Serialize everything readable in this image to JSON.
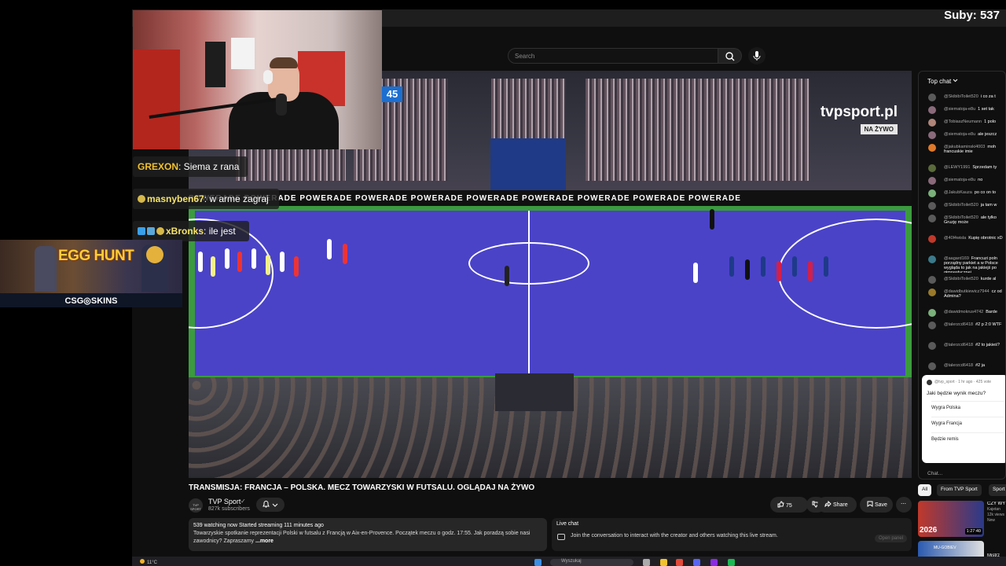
{
  "overlay": {
    "subs": "Suby: 537",
    "chat": [
      {
        "user": "GREXON",
        "text": ": Siema z rana"
      },
      {
        "user": "masnyben67",
        "text": ": w arme zagraj"
      },
      {
        "user": "xBronks",
        "text": ": ile jest"
      }
    ],
    "ad": {
      "title": "EGG HUNT",
      "brand": "CSG◎SKINS"
    }
  },
  "youtube": {
    "search_placeholder": "Search",
    "video": {
      "score": "45",
      "watermark": "tvpsport.pl",
      "watermark_live": "NA ŻYWO",
      "adboard": "POWERADE   POWERADE   POWERADE   POWERADE   POWERADE   POWERADE   POWERADE   POWERADE   POWERADE   POWERADE"
    },
    "title": "TRANSMISJA: FRANCJA – POLSKA. MECZ TOWARZYSKI W FUTSALU. OGLĄDAJ NA ŻYWO",
    "channel": {
      "name": "TVP Sport",
      "verified": "✓",
      "subs": "827k subscribers",
      "avatar_text": "TVP SPORT"
    },
    "actions": {
      "likes": "75",
      "share": "Share",
      "save": "Save",
      "more": "⋯"
    },
    "description": {
      "stats": "539 watching now  Started streaming 111 minutes ago",
      "text": "Towarzyskie spotkanie reprezentacji Polski w futsalu z Francją w Aix-en-Provence. Początek meczu o godz. 17:55. Jak poradzą sobie nasi zawodnicy? Zapraszamy",
      "more": "...more"
    },
    "live_chat_bar": {
      "title": "Live chat",
      "join": "Join the conversation to interact with the creator and others watching this live stream.",
      "open": "Open panel"
    },
    "chat_panel": {
      "header": "Top chat",
      "messages": [
        {
          "user": "@SkibibiToilet520",
          "text": "i co za t",
          "color": "#5a5a5a"
        },
        {
          "user": "@siematoja-e8u",
          "text": "1 set tak",
          "color": "#8a6a7a"
        },
        {
          "user": "@TobiaszNeumann",
          "text": "1 polo",
          "color": "#b0857a"
        },
        {
          "user": "@siematoja-e8u",
          "text": "ale jeszcz",
          "color": "#8a6a7a"
        },
        {
          "user": "@jakubkaminski4003",
          "text": "moh francuskie imie",
          "color": "#e07a2a",
          "tall": true
        },
        {
          "user": "@LEWY1991",
          "text": "Sprzedam ty",
          "color": "#5a6a3a"
        },
        {
          "user": "@siematoja-e8u",
          "text": "no",
          "color": "#8a6a7a"
        },
        {
          "user": "@JakubKauza",
          "text": "po co on to",
          "color": "#7ab07a"
        },
        {
          "user": "@SkibibiToilet520",
          "text": "ja tam w",
          "color": "#5a5a5a"
        },
        {
          "user": "@SkibibiToilet520",
          "text": "ale tylko Gruzję może",
          "color": "#5a5a5a",
          "tall": true
        },
        {
          "user": "@40l4wisla",
          "text": "Kupię obrotnic xD",
          "color": "#c0392b",
          "tall": true
        },
        {
          "user": "@aagard169",
          "text": "Francuzi poln porządny parkiet a w Polsce wygląda to jak na jakiejś po gimnastycznej.",
          "color": "#3a7a8a",
          "tall": true
        },
        {
          "user": "@SkibibiToilet520",
          "text": "kurde al",
          "color": "#5a5a5a"
        },
        {
          "user": "@dawidbutkiewicz7944",
          "text": "cz od Admina?",
          "color": "#9a7a2a",
          "tall": true
        },
        {
          "user": "@dawidmokrus4742",
          "text": "Barde",
          "color": "#7ab07a"
        },
        {
          "user": "@talerzcd6418",
          "text": "#2 p 2:0 WTF",
          "color": "#5a5a5a",
          "tall": true
        },
        {
          "user": "@talerzcd6418",
          "text": "#2 to jakieś?",
          "color": "#5a5a5a",
          "tall": true
        },
        {
          "user": "@talerzcd6418",
          "text": "#2 ja",
          "color": "#5a5a5a"
        }
      ],
      "poll": {
        "meta": "@tvp_sport · 1 hr ago · 425 vote",
        "question": "Jaki będzie wynik meczu?",
        "options": [
          "Wygra Polska",
          "Wygra Francja",
          "Będzie remis"
        ]
      },
      "input_placeholder": "Chat..."
    },
    "chips": [
      "All",
      "From TVP Sport",
      "Sport"
    ],
    "recommendations": [
      {
        "thumb_text": "2026",
        "time": "1:27:40",
        "title": "CZY WY WIDZEW",
        "channel": "Kajetan",
        "views": "12k views",
        "badge": "New"
      },
      {
        "thumb_text": "MU-GOBIEV",
        "title": "Mistrz"
      }
    ]
  },
  "taskbar": {
    "weather": "11°C",
    "search": "Wyszukaj"
  }
}
